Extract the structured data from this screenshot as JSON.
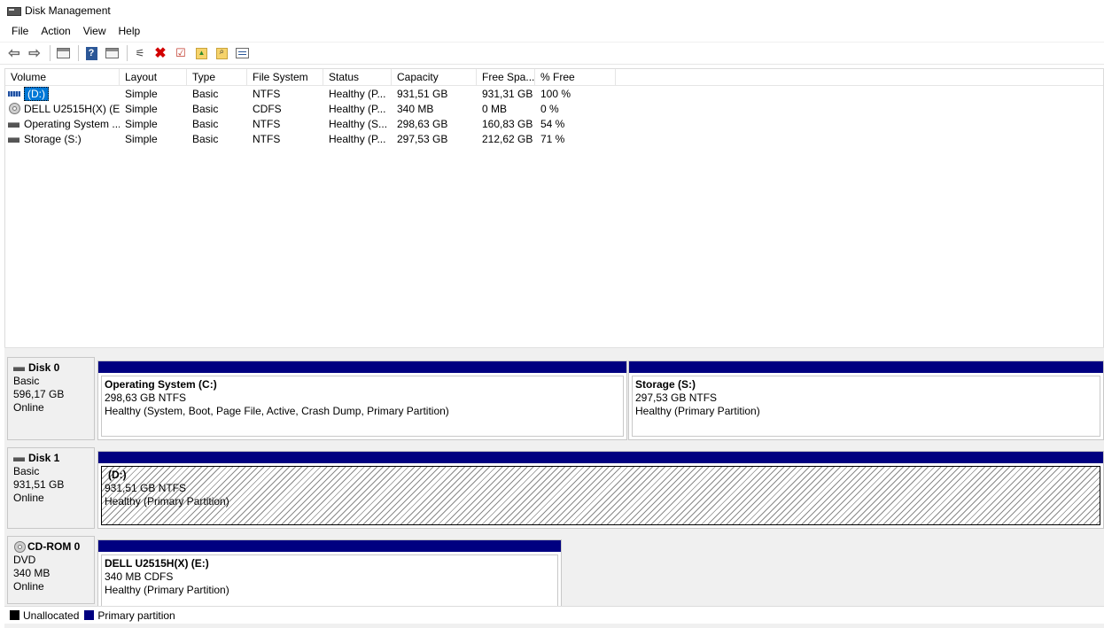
{
  "window": {
    "title": "Disk Management",
    "title_icon": "disk-management-icon"
  },
  "menu": [
    "File",
    "Action",
    "View",
    "Help"
  ],
  "toolbar": {
    "buttons": [
      "back-icon",
      "forward-icon",
      "console-tree-icon",
      "help-icon",
      "show-hide-icon",
      "connect-disk-icon",
      "delete-icon",
      "check-icon",
      "folder-up-icon",
      "folder-search-icon",
      "properties-icon"
    ]
  },
  "volume_list": {
    "columns": [
      "Volume",
      "Layout",
      "Type",
      "File System",
      "Status",
      "Capacity",
      "Free Spa...",
      "% Free"
    ],
    "rows": [
      {
        "icon": "hdd-blue",
        "volume": "(D:)",
        "layout": "Simple",
        "type": "Basic",
        "fs": "NTFS",
        "status": "Healthy (P...",
        "capacity": "931,51 GB",
        "free": "931,31 GB",
        "pct": "100 %",
        "selected": true
      },
      {
        "icon": "cd",
        "volume": "DELL U2515H(X) (E:)",
        "layout": "Simple",
        "type": "Basic",
        "fs": "CDFS",
        "status": "Healthy (P...",
        "capacity": "340 MB",
        "free": "0 MB",
        "pct": "0 %"
      },
      {
        "icon": "hdd",
        "volume": "Operating System ...",
        "layout": "Simple",
        "type": "Basic",
        "fs": "NTFS",
        "status": "Healthy (S...",
        "capacity": "298,63 GB",
        "free": "160,83 GB",
        "pct": "54 %"
      },
      {
        "icon": "hdd",
        "volume": "Storage (S:)",
        "layout": "Simple",
        "type": "Basic",
        "fs": "NTFS",
        "status": "Healthy (P...",
        "capacity": "297,53 GB",
        "free": "212,62 GB",
        "pct": "71 %"
      }
    ]
  },
  "disks": [
    {
      "name": "Disk 0",
      "type": "Basic",
      "size": "596,17 GB",
      "state": "Online",
      "partitions": [
        {
          "name": "Operating System  (C:)",
          "size": "298,63 GB NTFS",
          "status": "Healthy (System, Boot, Page File, Active, Crash Dump, Primary Partition)"
        },
        {
          "name": "Storage  (S:)",
          "size": "297,53 GB NTFS",
          "status": "Healthy (Primary Partition)"
        }
      ]
    },
    {
      "name": "Disk 1",
      "type": "Basic",
      "size": "931,51 GB",
      "state": "Online",
      "partitions": [
        {
          "name": "(D:)",
          "size": "931,51 GB NTFS",
          "status": "Healthy (Primary Partition)",
          "selected": true
        }
      ]
    },
    {
      "name": "CD-ROM 0",
      "type": "DVD",
      "size": "340 MB",
      "state": "Online",
      "partitions": [
        {
          "name": "DELL U2515H(X)  (E:)",
          "size": "340 MB CDFS",
          "status": "Healthy (Primary Partition)"
        }
      ]
    }
  ],
  "legend": [
    {
      "label": "Unallocated",
      "color": "#000000"
    },
    {
      "label": "Primary partition",
      "color": "#000080"
    }
  ]
}
